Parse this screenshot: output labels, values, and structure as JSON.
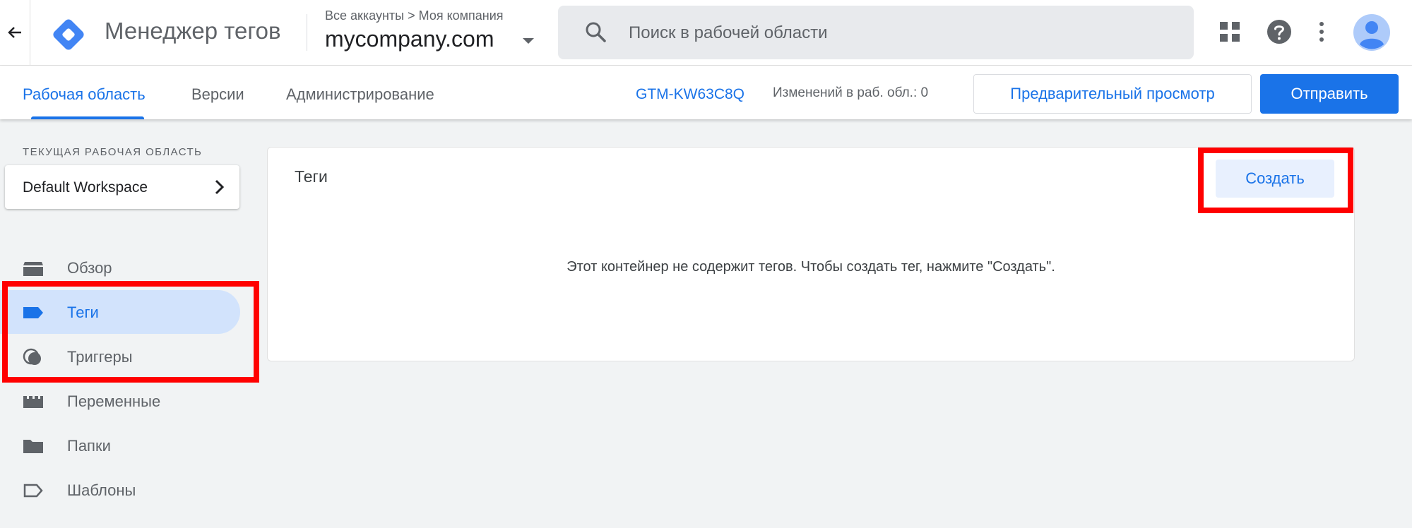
{
  "header": {
    "product_name": "Менеджер тегов",
    "breadcrumb": "Все аккаунты > Моя компания",
    "account_name": "mycompany.com",
    "search_placeholder": "Поиск в рабочей области"
  },
  "subnav": {
    "tabs": [
      {
        "label": "Рабочая область",
        "active": true
      },
      {
        "label": "Версии",
        "active": false
      },
      {
        "label": "Администрирование",
        "active": false
      }
    ],
    "container_id": "GTM-KW63C8Q",
    "changes_label": "Изменений в раб. обл.: 0",
    "preview_label": "Предварительный просмотр",
    "submit_label": "Отправить"
  },
  "sidebar": {
    "workspace_heading": "ТЕКУЩАЯ РАБОЧАЯ ОБЛАСТЬ",
    "workspace_name": "Default Workspace",
    "items": [
      {
        "label": "Обзор",
        "icon": "overview-icon",
        "active": false
      },
      {
        "label": "Теги",
        "icon": "tag-icon",
        "active": true
      },
      {
        "label": "Триггеры",
        "icon": "trigger-icon",
        "active": false
      },
      {
        "label": "Переменные",
        "icon": "variables-icon",
        "active": false
      },
      {
        "label": "Папки",
        "icon": "folder-icon",
        "active": false
      },
      {
        "label": "Шаблоны",
        "icon": "template-icon",
        "active": false
      }
    ]
  },
  "main": {
    "panel_title": "Теги",
    "create_label": "Создать",
    "empty_message": "Этот контейнер не содержит тегов. Чтобы создать тег, нажмите \"Создать\"."
  },
  "colors": {
    "accent": "#1a73e8",
    "highlight": "#ff0000",
    "active_nav_bg": "#d2e3fc"
  }
}
